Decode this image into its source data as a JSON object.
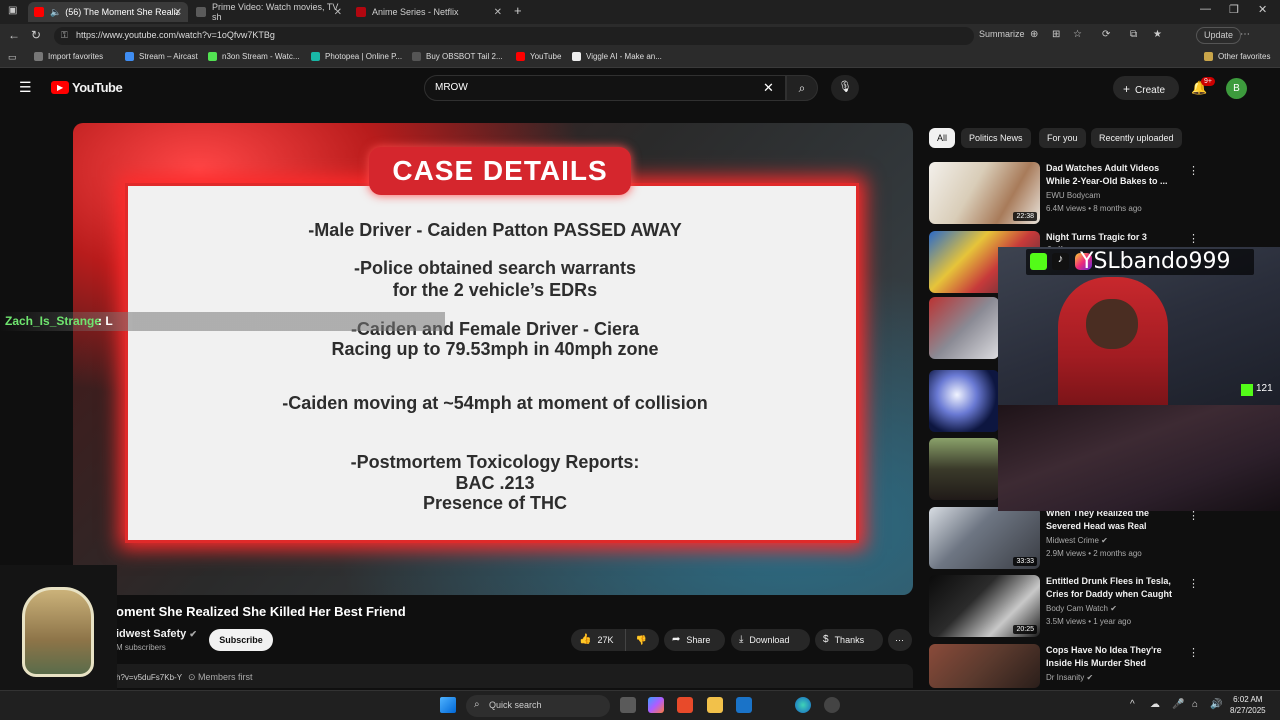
{
  "browser": {
    "tabs": [
      {
        "label": "(56) The Moment She Realiz",
        "active": true
      },
      {
        "label": "Prime Video: Watch movies, TV sh",
        "active": false
      },
      {
        "label": "Anime Series - Netflix",
        "active": false
      }
    ],
    "url": "https://www.youtube.com/watch?v=1oQfvw7KTBg",
    "summarize": "Summarize",
    "update": "Update",
    "bookmarks": [
      "Import favorites",
      "Stream – Aircast",
      "n3on Stream - Watc...",
      "Photopea | Online P...",
      "Buy OBSBOT Tail 2...",
      "YouTube",
      "Viggle AI - Make an..."
    ],
    "other_favorites": "Other favorites"
  },
  "youtube": {
    "logo": "YouTube",
    "search_value": "MROW",
    "create": "Create",
    "notif_badge": "9+",
    "avatar": "B"
  },
  "video": {
    "slide_title": "CASE DETAILS",
    "lines": [
      "-Male Driver - Caiden Patton PASSED AWAY",
      "-Police obtained search warrants",
      "for the 2 vehicle’s EDRs",
      "-Caiden and Female Driver - Ciera",
      "Racing up to 79.53mph in 40mph zone",
      "-Caiden moving at ~54mph at moment of collision",
      "-Postmortem Toxicology Reports:",
      "BAC .213",
      "Presence of THC"
    ],
    "chat_user": "Zach_Is_Strange",
    "chat_msg": ": L"
  },
  "meta": {
    "title": "oment She Realized She Killed Her Best Friend",
    "channel": "idwest Safety",
    "subs": "M subscribers",
    "subscribe": "Subscribe",
    "likes": "27K",
    "share": "Share",
    "download": "Download",
    "thanks": "Thanks",
    "desc_start": "h?v=v5duFs7Kb-Y",
    "members": "Members first"
  },
  "chips": [
    "All",
    "Politics News",
    "For you",
    "Recently uploaded"
  ],
  "related": [
    {
      "title": "Dad Watches Adult Videos While 2-Year-Old Bakes to ...",
      "channel": "EWU Bodycam",
      "meta": "6.4M views • 8 months ago",
      "duration": "22:38"
    },
    {
      "title": "Night Turns Tragic for 3 College",
      "channel": "",
      "meta": "",
      "duration": ""
    },
    {
      "title": "When They Realized the Severed Head was Real",
      "channel": "Midwest Crime",
      "meta": "2.9M views • 2 months ago",
      "duration": "33:33"
    },
    {
      "title": "Entitled Drunk Flees in Tesla, Cries for Daddy when Caught",
      "channel": "Body Cam Watch",
      "meta": "3.5M views • 1 year ago",
      "duration": "20:25"
    },
    {
      "title": "Cops Have No Idea They're Inside His Murder Shed",
      "channel": "Dr Insanity",
      "meta": "",
      "duration": ""
    }
  ],
  "overlay": {
    "streamer": "YSLbando999",
    "kick_count": "121"
  },
  "taskbar": {
    "search": "Quick search",
    "time": "6:02 AM",
    "date": "8/27/2025"
  }
}
